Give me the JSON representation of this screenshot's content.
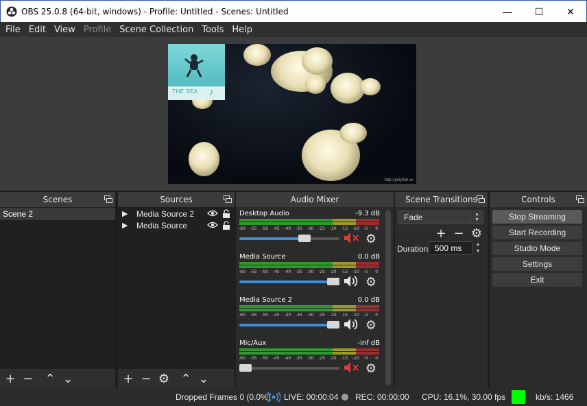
{
  "window": {
    "title": "OBS 25.0.8 (64-bit, windows) - Profile: Untitled - Scenes: Untitled",
    "minimize": "—",
    "maximize": "☐",
    "close": "✕"
  },
  "menu": [
    {
      "label": "File",
      "enabled": true
    },
    {
      "label": "Edit",
      "enabled": true
    },
    {
      "label": "View",
      "enabled": true
    },
    {
      "label": "Profile",
      "enabled": false
    },
    {
      "label": "Scene Collection",
      "enabled": true
    },
    {
      "label": "Tools",
      "enabled": true
    },
    {
      "label": "Help",
      "enabled": true
    }
  ],
  "preview": {
    "thumbnail_caption": "THE SEA",
    "thumbnail_note": "♪",
    "watermark": "http://jellyfish.xx"
  },
  "docks": {
    "scenes": {
      "title": "Scenes",
      "items": [
        "Scene 2"
      ]
    },
    "sources": {
      "title": "Sources",
      "items": [
        "Media Source 2",
        "Media Source"
      ]
    },
    "mixer": {
      "title": "Audio Mixer",
      "scale": [
        "-60",
        "-55",
        "-50",
        "-45",
        "-40",
        "-35",
        "-30",
        "-25",
        "-20",
        "-15",
        "-10",
        "-5",
        "0"
      ],
      "channels": [
        {
          "name": "Desktop Audio",
          "db": "-9.3 dB",
          "volume": 0.65,
          "muted": true
        },
        {
          "name": "Media Source",
          "db": "0.0 dB",
          "volume": 1.0,
          "muted": false
        },
        {
          "name": "Media Source 2",
          "db": "0.0 dB",
          "volume": 1.0,
          "muted": false
        },
        {
          "name": "Mic/Aux",
          "db": "-inf dB",
          "volume": 0.0,
          "muted": true
        }
      ]
    },
    "transitions": {
      "title": "Scene Transitions",
      "selected": "Fade",
      "duration_label": "Duration",
      "duration_value": "500 ms"
    },
    "controls": {
      "title": "Controls",
      "buttons": [
        "Stop Streaming",
        "Start Recording",
        "Studio Mode",
        "Settings",
        "Exit"
      ]
    }
  },
  "status": {
    "dropped_frames": "Dropped Frames 0 (0.0%)",
    "live": "LIVE: 00:00:04",
    "rec": "REC: 00:00:00",
    "cpu": "CPU: 16.1%, 30.00 fps",
    "kbps": "kb/s: 1466",
    "stream_health_color": "#00ff00"
  }
}
